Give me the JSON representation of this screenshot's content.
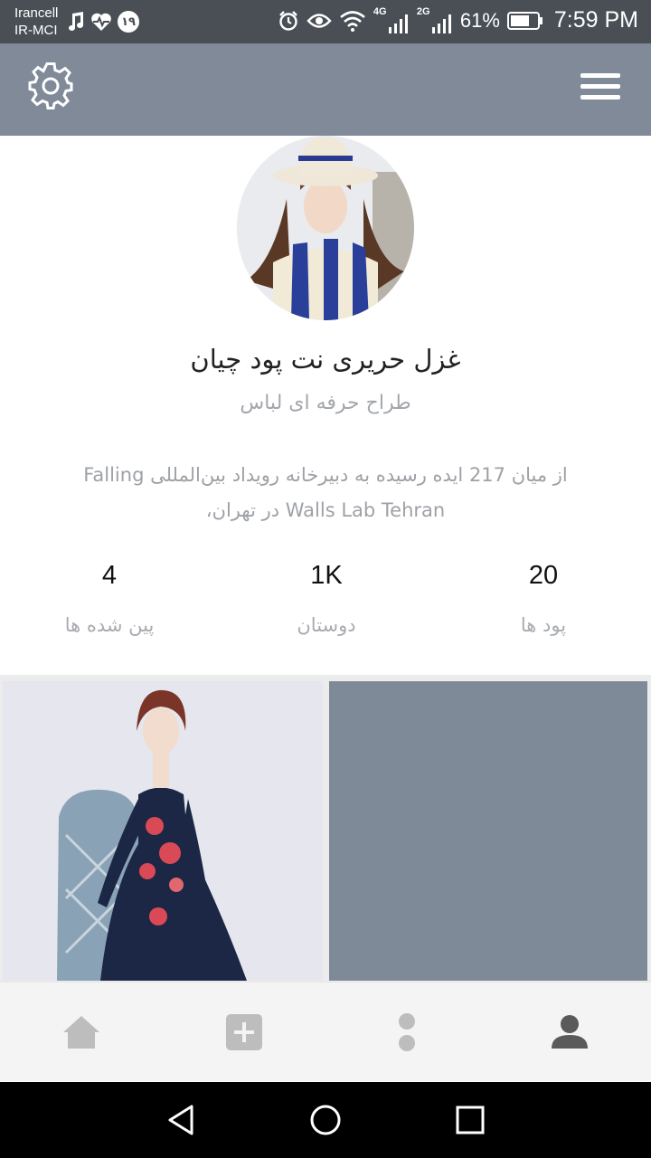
{
  "status_bar": {
    "carrier_line1": "Irancell",
    "carrier_line2": "IR-MCI",
    "badge": "۱۹",
    "network_4g": "4G",
    "network_2g": "2G",
    "battery": "61%",
    "time": "7:59 PM"
  },
  "header": {
    "left_icon": "gear-icon",
    "right_icon": "menu-icon"
  },
  "profile": {
    "name": "غزل حریری نت پود چیان",
    "role": "طراح حرفه ای لباس",
    "bio_line1": "از میان 217 ایده رسیده به دبیرخانه رویداد بین‌المللی Falling",
    "bio_line2": "Walls Lab Tehran در تهران،"
  },
  "stats": [
    {
      "value": "4",
      "label": "پین شده ها"
    },
    {
      "value": "1K",
      "label": "دوستان"
    },
    {
      "value": "20",
      "label": "پود ها"
    }
  ],
  "tab_bar": {
    "active": "profile",
    "tabs": [
      "home-icon",
      "add-icon",
      "dots-icon",
      "profile-icon"
    ],
    "active_color": "#5a5a5a",
    "inactive_color": "#bdbdbd"
  },
  "colors": {
    "header": "#808a98",
    "status_bar": "#4a4f56",
    "placeholder_tile": "#7f8a98"
  }
}
